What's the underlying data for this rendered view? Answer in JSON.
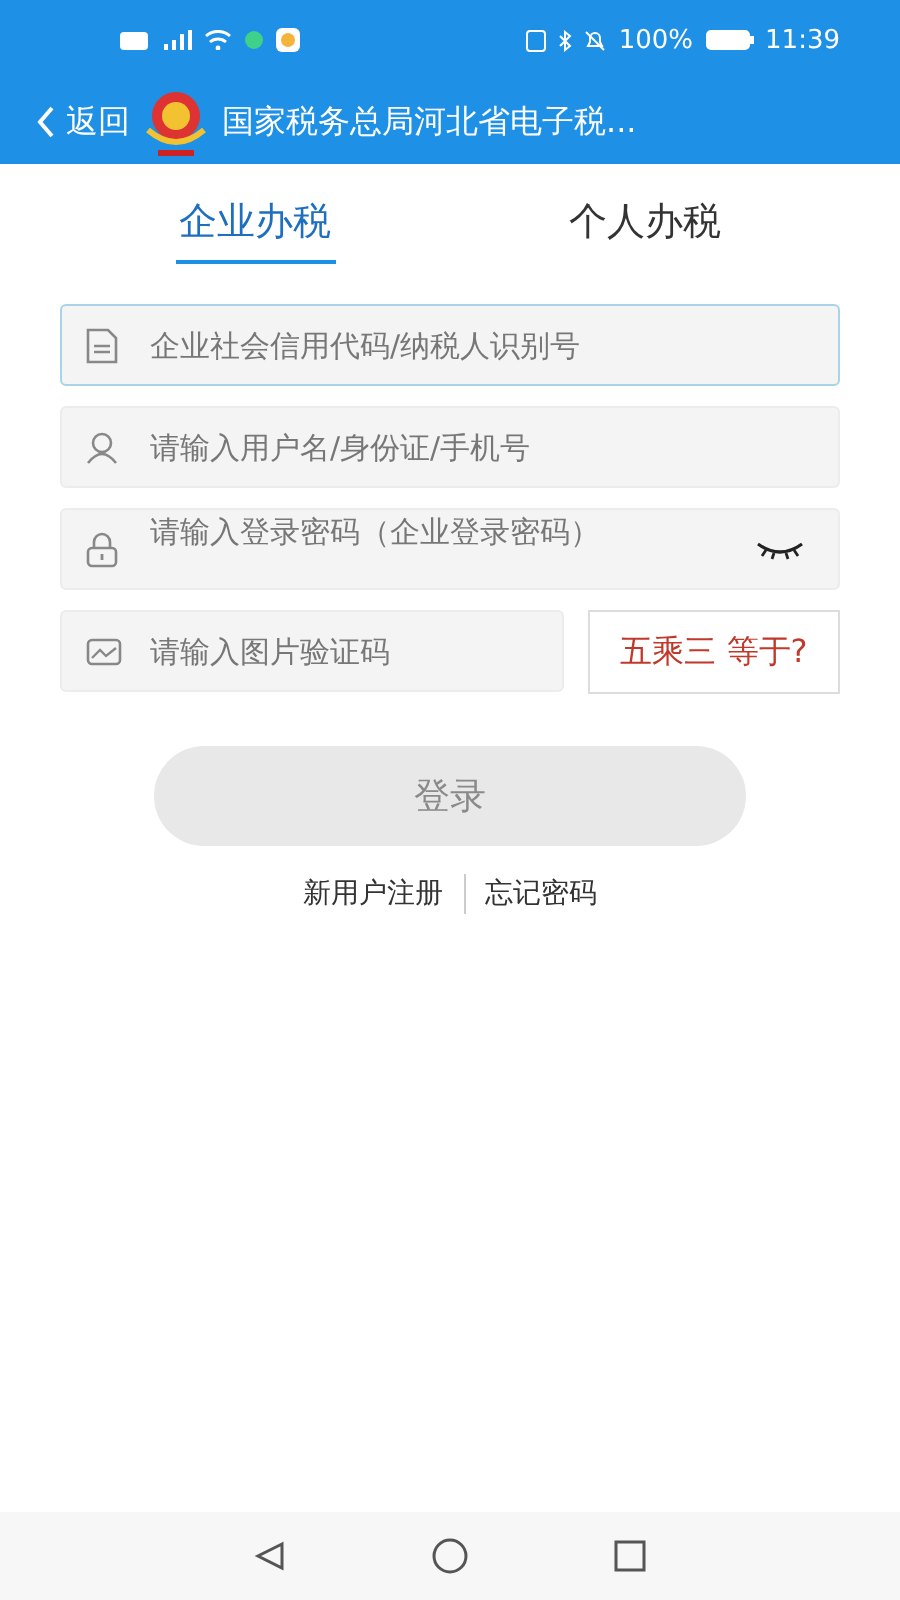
{
  "status_bar": {
    "battery": "100%",
    "time": "11:39"
  },
  "header": {
    "back": "返回",
    "title": "国家税务总局河北省电子税..."
  },
  "tabs": [
    {
      "label": "企业办税",
      "selected": true
    },
    {
      "label": "个人办税",
      "selected": false
    }
  ],
  "fields": [
    {
      "kind": "document",
      "placeholder": "企业社会信用代码/纳税人识别号",
      "focused": true
    },
    {
      "kind": "user",
      "placeholder": "请输入用户名/身份证/手机号",
      "focused": false
    },
    {
      "kind": "password",
      "placeholder": "请输入登录密码（企业登录密码）",
      "focused": false
    },
    {
      "kind": "captcha",
      "placeholder": "请输入图片验证码",
      "focused": false
    }
  ],
  "captcha": "五乘三 等于?",
  "login_button": {
    "label": "登录",
    "disabled": true
  },
  "links": [
    "新用户注册",
    "忘记密码"
  ]
}
